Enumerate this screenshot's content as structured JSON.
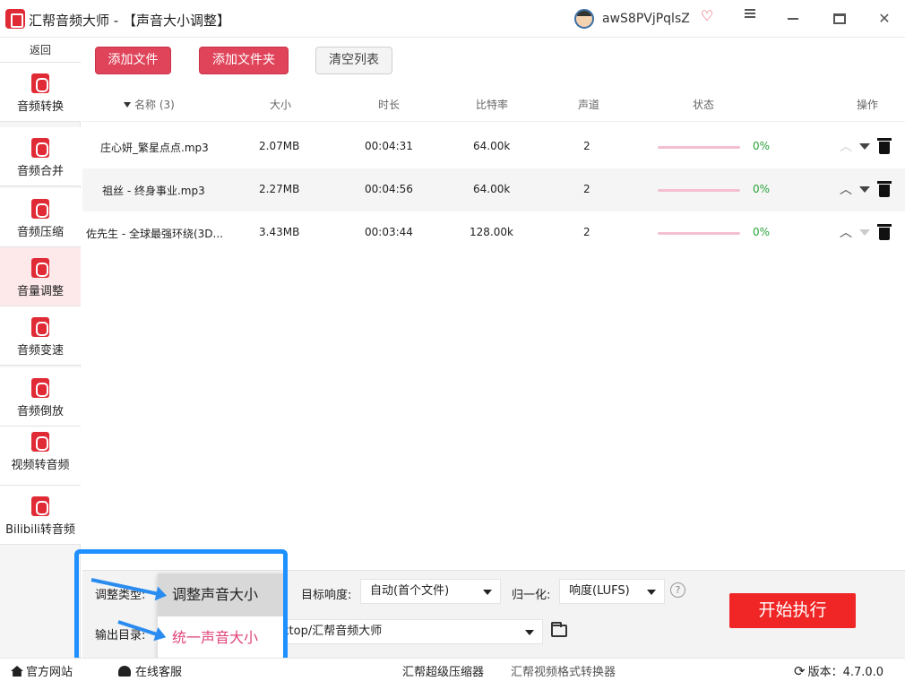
{
  "titlebar": {
    "app_name": "汇帮音频大师",
    "separator": "-",
    "page_title": "【声音大小调整】",
    "user_name": "awS8PVjPqlsZ",
    "vip_glyph": "♡"
  },
  "sidebar": {
    "back": "返回",
    "items": [
      {
        "label": "音频转换",
        "icon": "audio-convert-icon"
      },
      {
        "label": "音频合并",
        "icon": "audio-merge-icon"
      },
      {
        "label": "音频压缩",
        "icon": "audio-compress-icon"
      },
      {
        "label": "音量调整",
        "icon": "volume-adjust-icon",
        "active": true
      },
      {
        "label": "音频变速",
        "icon": "audio-speed-icon"
      },
      {
        "label": "音频倒放",
        "icon": "audio-reverse-icon"
      },
      {
        "label": "视频转音频",
        "icon": "video-to-audio-icon"
      },
      {
        "label": "Bilibili转音频",
        "icon": "bilibili-icon"
      }
    ]
  },
  "toolbar": {
    "add_file": "添加文件",
    "add_folder": "添加文件夹",
    "clear_list": "清空列表"
  },
  "table": {
    "columns": {
      "name": "名称 (3)",
      "size": "大小",
      "duration": "时长",
      "bitrate": "比特率",
      "channels": "声道",
      "status": "状态",
      "actions": "操作"
    },
    "rows": [
      {
        "name": "庄心妍_繁星点点.mp3",
        "size": "2.07MB",
        "duration": "00:04:31",
        "bitrate": "64.00k",
        "channels": "2",
        "progress": "0%"
      },
      {
        "name": "祖丝 - 终身事业.mp3",
        "size": "2.27MB",
        "duration": "00:04:56",
        "bitrate": "64.00k",
        "channels": "2",
        "progress": "0%"
      },
      {
        "name": "佐先生 - 全球最强环绕(3D...",
        "size": "3.43MB",
        "duration": "00:03:44",
        "bitrate": "128.00k",
        "channels": "2",
        "progress": "0%"
      }
    ]
  },
  "bottom": {
    "adjust_type_label": "调整类型:",
    "output_dir_label": "输出目录:",
    "target_loudness_label": "目标响度:",
    "target_loudness_value": "自动(首个文件)",
    "normalize_label": "归一化:",
    "normalize_value": "响度(LUFS)",
    "help_glyph": "?",
    "output_path": "ktop/汇帮音频大师",
    "start": "开始执行",
    "dropdown": {
      "option_selected": "调整声音大小",
      "option_second": "统一声音大小"
    }
  },
  "statusbar": {
    "website": "官方网站",
    "service": "在线客服",
    "compressor": "汇帮超级压缩器",
    "video_converter": "汇帮视频格式转换器",
    "version": "版本：4.7.0.0"
  },
  "colors": {
    "brand_red": "#e02a35",
    "button_red": "#e0445a",
    "start_red": "#f02626",
    "progress_pink": "#f4c0cf",
    "percent_green": "#2aa33b",
    "highlight_blue": "#1e90ff"
  }
}
